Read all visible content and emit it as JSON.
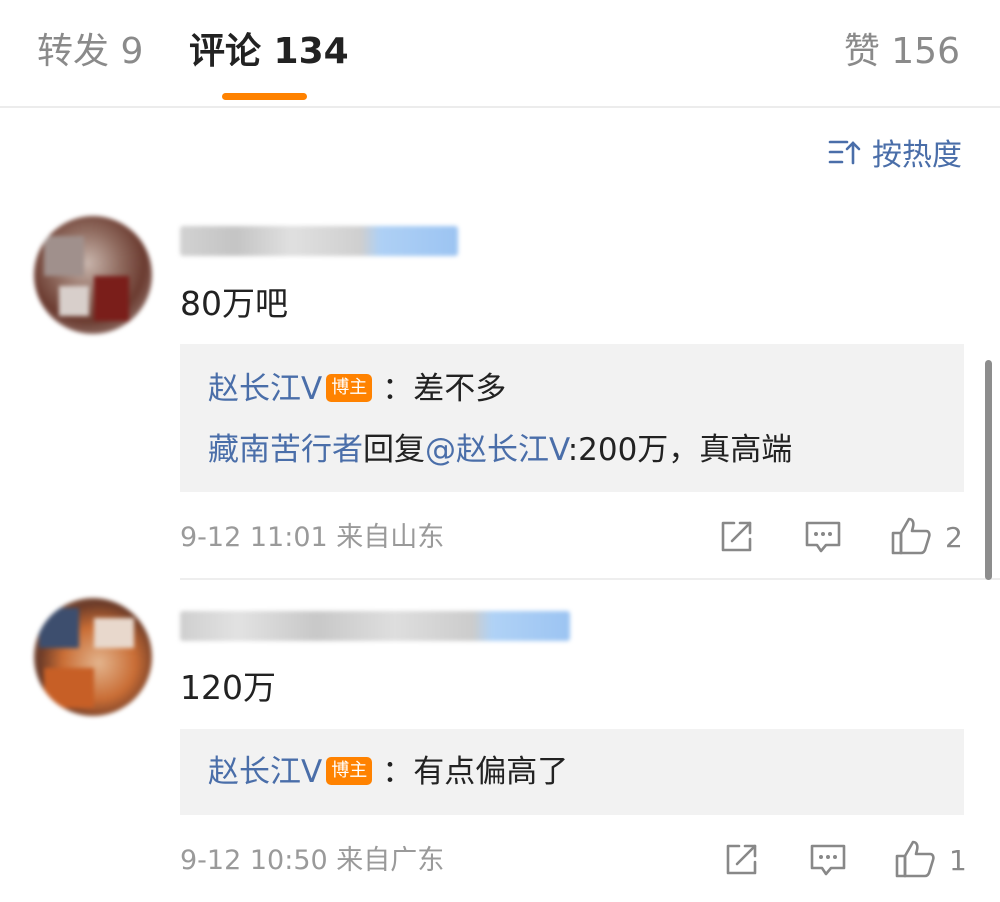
{
  "tabs": {
    "repost": "转发 9",
    "comment": "评论 134",
    "like": "赞 156"
  },
  "sort": {
    "label": "按热度",
    "icon": "sort-icon"
  },
  "colors": {
    "accent": "#ff8200",
    "link": "#4a6ea9"
  },
  "comments": [
    {
      "text": "80万吧",
      "replies": [
        {
          "user": "赵长江V",
          "badge": "博主",
          "separator": "：",
          "text": "差不多"
        },
        {
          "user": "藏南苦行者",
          "middle": "回复",
          "target": "@赵长江V",
          "text": ":200万，真高端"
        }
      ],
      "meta": "9-12 11:01 来自山东",
      "likes": "2"
    },
    {
      "text": "120万",
      "replies": [
        {
          "user": "赵长江V",
          "badge": "博主",
          "separator": "：",
          "text": "有点偏高了"
        }
      ],
      "meta": "9-12 10:50 来自广东",
      "likes": "1"
    }
  ]
}
